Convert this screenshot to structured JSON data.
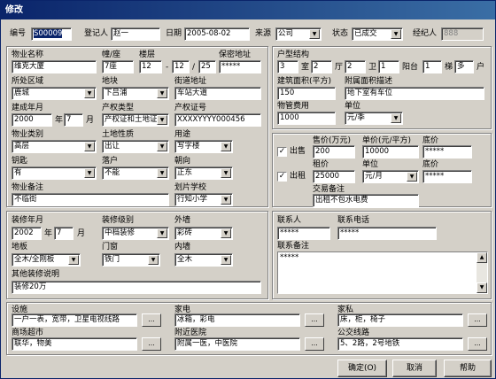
{
  "window": {
    "title": "修改"
  },
  "top": {
    "code_label": "编号",
    "code": "S00009",
    "registrar_label": "登记人",
    "registrar": "赵一",
    "date_label": "日期",
    "date": "2005-08-02",
    "source_label": "来源",
    "source": "公司",
    "status_label": "状态",
    "status": "已成交",
    "agent_label": "经纪人",
    "agent": "888"
  },
  "property": {
    "name_label": "物业名称",
    "name": "维克大厦",
    "building_label": "幢/座",
    "building": "7座",
    "floor_label": "楼层",
    "floor_a": "12",
    "floor_sep": "-",
    "floor_b": "12",
    "floor_c": "25",
    "floor_slash": "/",
    "key_label": "保密地址",
    "key": "*****",
    "district_label": "所处区域",
    "district": "鹿城",
    "section_label": "地块",
    "section": "下吕浦",
    "street_label": "街道地址",
    "street": "车站大道",
    "year_built_label": "建成年月",
    "year_built": "2000",
    "year_unit": "年",
    "month_built": "7",
    "month_unit": "月",
    "rights_type_label": "产权类型",
    "rights_type": "产权证和土地证",
    "rights_no_label": "产权证号",
    "rights_no": "XXXXYYYY000456",
    "ptype_label": "物业类别",
    "ptype": "高层",
    "land_label": "土地性质",
    "land": "出让",
    "usage_label": "用途",
    "usage": "写字楼",
    "key2_label": "钥匙",
    "key2": "有",
    "hukou_label": "落户",
    "hukou": "不能",
    "orient_label": "朝向",
    "orient": "正东",
    "note_label": "物业备注",
    "note": "不临街",
    "school_label": "划片学校",
    "school": "行知小学"
  },
  "layout": {
    "label": "户型结构",
    "rooms": "3",
    "room_u": "室",
    "halls": "2",
    "hall_u": "厅",
    "baths": "2",
    "bath_u": "卫",
    "balc": "1",
    "balc_u": "阳台",
    "stairs": "1",
    "stair_u": "梯",
    "units": "多",
    "unit_u": "户",
    "area_label": "建筑面积(平方)",
    "area": "150",
    "attach_label": "附属面积描述",
    "attach": "地下室有车位",
    "fee_label": "物管费用",
    "fee": "1000",
    "fee_unit_label": "单位",
    "fee_unit": "元/季"
  },
  "deal": {
    "sell_label": "出售",
    "sell_price_label": "售价(万元)",
    "sell_price": "200",
    "unit_price_label": "单价(元/平方)",
    "unit_price": "10000",
    "sell_floor_label": "底价",
    "sell_floor": "*****",
    "rent_label": "出租",
    "rent_price_label": "租价",
    "rent_price": "25000",
    "rent_unit_label": "单位",
    "rent_unit": "元/月",
    "rent_floor_label": "底价",
    "rent_floor": "*****",
    "note_label": "交易备注",
    "note": "出租不包水电费"
  },
  "decor": {
    "year_label": "装修年月",
    "year": "2002",
    "year_u": "年",
    "month": "7",
    "month_u": "月",
    "grade_label": "装修级别",
    "grade": "中档装修",
    "outer_label": "外墙",
    "outer": "彩砖",
    "floor_label": "地板",
    "floor": "全木/全刚板",
    "door_label": "门窗",
    "door": "铁门",
    "inner_label": "内墙",
    "inner": "全木",
    "other_label": "其他装修说明",
    "other": "装修20万"
  },
  "contact": {
    "person_label": "联系人",
    "person": "*****",
    "phone_label": "联系电话",
    "phone": "*****",
    "note_label": "联系备注",
    "note": "*****"
  },
  "facilities": {
    "fac_label": "设施",
    "fac": "一户一表，宽带，卫星电视线路",
    "appl_label": "家电",
    "appl": "冰箱，彩电",
    "furn_label": "家私",
    "furn": "床，柜，椅子",
    "mall_label": "商场超市",
    "mall": "联华，物美",
    "hosp_label": "附近医院",
    "hosp": "附属一医，中医院",
    "bus_label": "公交线路",
    "bus": "5、2路，2号地铁",
    "dots": "..."
  },
  "buttons": {
    "ok": "确定(O)",
    "cancel": "取消",
    "help": "帮助"
  }
}
